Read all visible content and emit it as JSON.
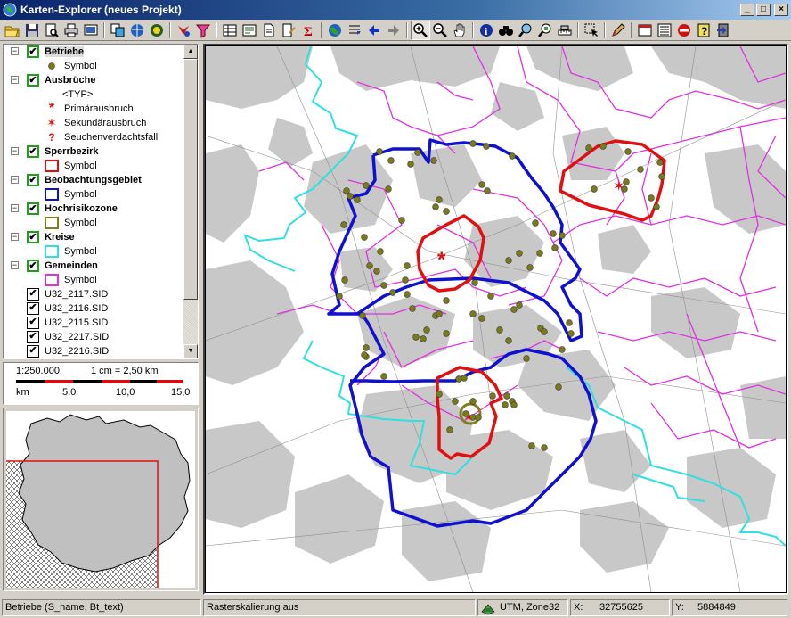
{
  "window": {
    "title": "Karten-Explorer (neues Projekt)",
    "minimize": "_",
    "maximize": "□",
    "close": "×"
  },
  "toolbar": {
    "buttons": [
      "open-folder-icon",
      "save-icon",
      "print-preview-icon",
      "print-icon",
      "export-icon",
      "copy-layer-icon",
      "globe-layers-icon",
      "theme-icon",
      "query-icon",
      "filter-icon",
      "table-icon",
      "attribute-icon",
      "document-icon",
      "edit-document-icon",
      "sum-icon",
      "globe-full-extent-icon",
      "previous-extent-icon",
      "arrow-left-icon",
      "arrow-right-icon",
      "zoom-in-icon",
      "zoom-out-icon",
      "pan-hand-icon",
      "info-icon",
      "binoculars-icon",
      "find-icon",
      "select-zoom-icon",
      "measure-icon",
      "selection-arrow-icon",
      "pencil-icon",
      "window-layout-icon",
      "list-icon",
      "no-entry-icon",
      "help-icon",
      "exit-icon"
    ],
    "pressed": "zoom-in-icon"
  },
  "legend": {
    "layers": [
      {
        "name": "Betriebe",
        "checked": true,
        "symbols": [
          {
            "label": "Symbol",
            "kind": "dot"
          }
        ]
      },
      {
        "name": "Ausbrüche",
        "checked": true,
        "symbols": [
          {
            "label": "<TYP>",
            "kind": "none"
          },
          {
            "label": "Primärausbruch",
            "kind": "asterisk-red"
          },
          {
            "label": "Sekundärausbruch",
            "kind": "star-red"
          },
          {
            "label": "Seuchenverdachtsfall",
            "kind": "question-red"
          }
        ]
      },
      {
        "name": "Sperrbezirk",
        "checked": true,
        "symbols": [
          {
            "label": "Symbol",
            "kind": "box",
            "color": "#e01010"
          }
        ]
      },
      {
        "name": "Beobachtungsgebiet",
        "checked": true,
        "symbols": [
          {
            "label": "Symbol",
            "kind": "box",
            "color": "#1010d0"
          }
        ]
      },
      {
        "name": "Hochrisikozone",
        "checked": true,
        "symbols": [
          {
            "label": "Symbol",
            "kind": "box",
            "color": "#808020"
          }
        ]
      },
      {
        "name": "Kreise",
        "checked": true,
        "symbols": [
          {
            "label": "Symbol",
            "kind": "box",
            "color": "#30e0e0"
          }
        ]
      },
      {
        "name": "Gemeinden",
        "checked": true,
        "symbols": [
          {
            "label": "Symbol",
            "kind": "box",
            "color": "#e030e0"
          }
        ]
      }
    ],
    "files": [
      "U32_2117.SID",
      "U32_2116.SID",
      "U32_2115.SID",
      "U32_2217.SID",
      "U32_2216.SID"
    ]
  },
  "scale": {
    "ratio": "1:250.000",
    "cm_text": "1 cm = 2,50 km",
    "ticks": [
      "km",
      "5,0",
      "10,0",
      "15,0"
    ]
  },
  "status": {
    "layer_info": "Betriebe (S_name, Bt_text)",
    "raster": "Rasterskalierung aus",
    "projection": "UTM, Zone32",
    "x_label": "X:",
    "x_value": "32755625",
    "y_label": "Y:",
    "y_value": "5884849"
  },
  "colors": {
    "sperrbezirk": "#e01010",
    "beobachtung": "#1010d0",
    "hochrisiko": "#808020",
    "kreise": "#30e0e0",
    "gemeinden": "#e030e0",
    "betrieb_dot": "#7a7a1a"
  }
}
